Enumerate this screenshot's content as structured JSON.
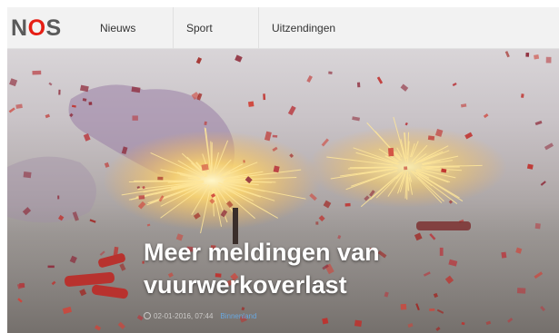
{
  "header": {
    "logo_text": "NOS",
    "nav": [
      {
        "label": "Nieuws"
      },
      {
        "label": "Sport"
      },
      {
        "label": "Uitzendingen"
      }
    ]
  },
  "article": {
    "headline": "Meer meldingen van vuurwerkoverlast",
    "timestamp": "02-01-2016, 07:44",
    "category": "Binnenland"
  },
  "colors": {
    "brand_red": "#e61e14",
    "logo_gray": "#5a5a5a",
    "category_blue": "#6aa8e0"
  }
}
